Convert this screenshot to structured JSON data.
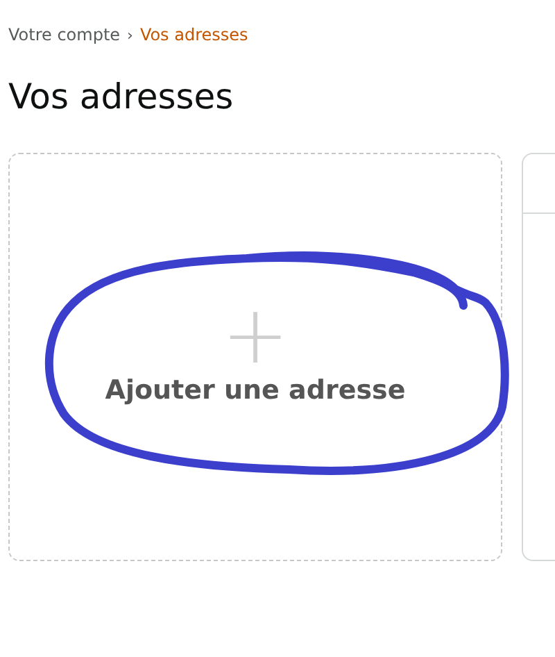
{
  "breadcrumb": [
    {
      "label": "Votre compte",
      "selected": false
    },
    {
      "label": "Vos adresses",
      "selected": true
    }
  ],
  "breadcrumb_separator": "›",
  "title": "Vos adresses",
  "add_card": {
    "icon": "+",
    "label": "Ajouter une adresse"
  }
}
